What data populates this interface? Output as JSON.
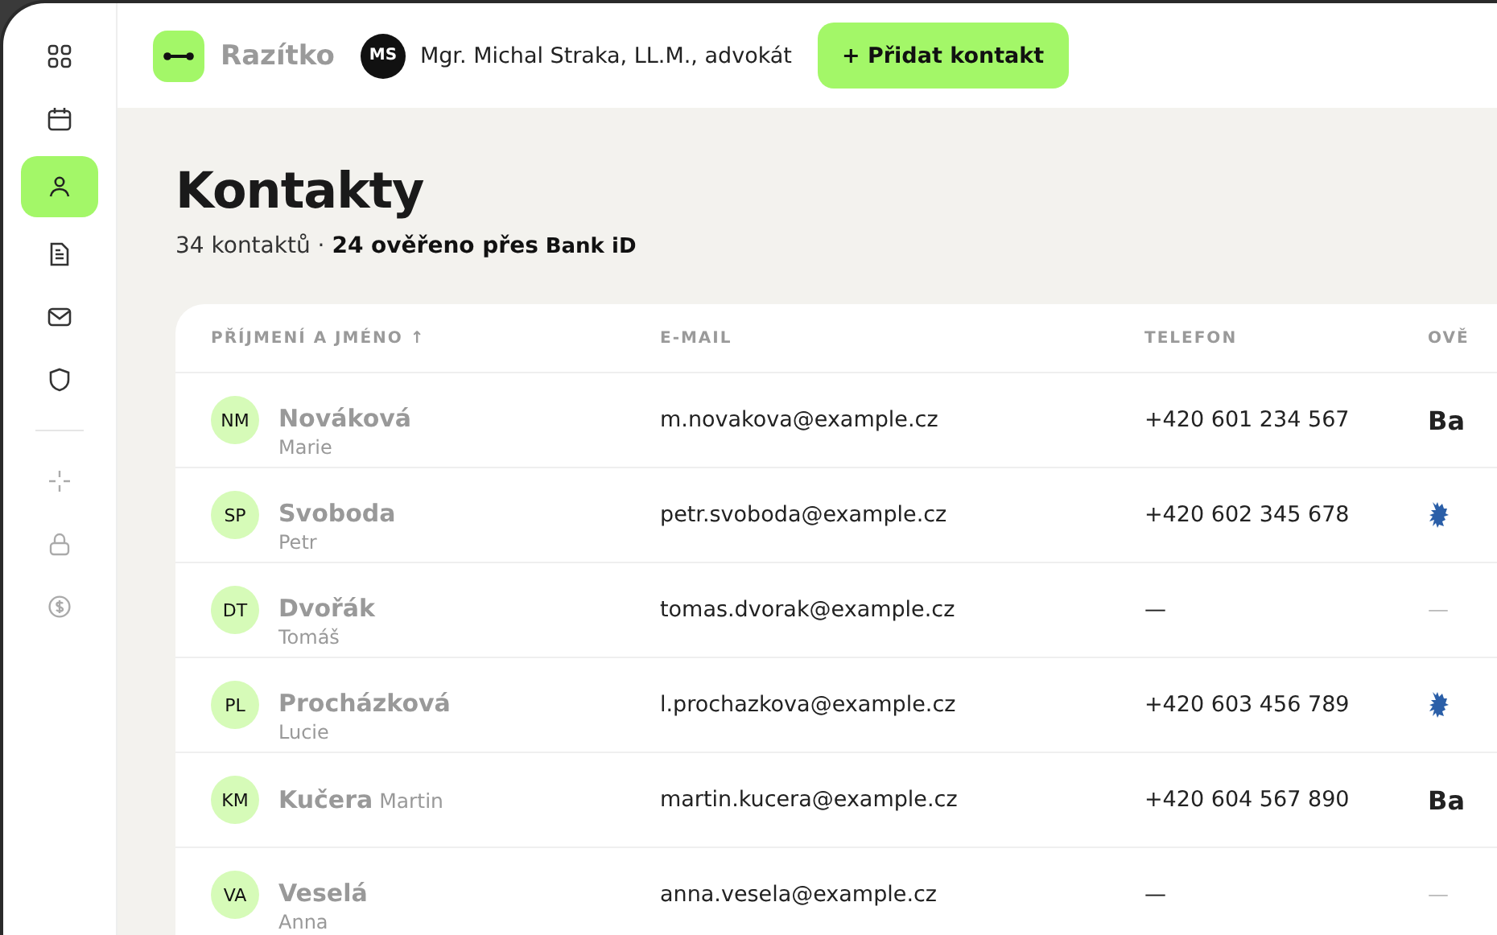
{
  "sidebar": {
    "items": [
      {
        "selected": false
      },
      {
        "selected": false
      },
      {
        "selected": true
      },
      {
        "selected": false
      },
      {
        "selected": false
      },
      {
        "selected": false
      }
    ],
    "tools": [
      {
        "selected": false
      },
      {
        "selected": false
      },
      {
        "selected": false
      }
    ]
  },
  "topbar": {
    "app_name": "Razítko",
    "user": {
      "initials": "MS",
      "name": "Mgr. Michal Straka, LL.M., advokát"
    },
    "add_button": "+ Přidat kontakt"
  },
  "page": {
    "title": "Kontakty",
    "count": "34 kontaktů",
    "separator": "·",
    "verified": "24 ověřeno přes",
    "bankid": "Bank iD"
  },
  "table": {
    "columns": [
      "PŘÍJMENÍ A JMÉNO ↑",
      "E-MAIL",
      "TELEFON",
      "OVĚ"
    ],
    "rows": [
      {
        "initials": "NM",
        "surname": "Nováková",
        "first_name": "Marie",
        "kind": "stacked",
        "email": "m.novakova@example.cz",
        "phone": "+420 601 234 567",
        "verification": {
          "kind": "bankid",
          "text": "Ba"
        }
      },
      {
        "initials": "SP",
        "surname": "Svoboda",
        "first_name": "Petr",
        "kind": "stacked",
        "email": "petr.svoboda@example.cz",
        "phone": "+420 602 345 678",
        "verification": {
          "kind": "emblem"
        }
      },
      {
        "initials": "DT",
        "surname": "Dvořák",
        "first_name": "Tomáš",
        "kind": "stacked",
        "email": "tomas.dvorak@example.cz",
        "phone": "—",
        "verification": {
          "kind": "none",
          "text": "—"
        }
      },
      {
        "initials": "PL",
        "surname": "Procházková",
        "first_name": "Lucie",
        "kind": "stacked",
        "email": "l.prochazkova@example.cz",
        "phone": "+420 603 456 789",
        "verification": {
          "kind": "emblem"
        }
      },
      {
        "initials": "KM",
        "full_name": "**Kučera** Martin",
        "kind": "inline",
        "email": "martin.kucera@example.cz",
        "phone": "+420 604 567 890",
        "verification": {
          "kind": "bankid",
          "text": "Ba"
        }
      },
      {
        "initials": "VA",
        "surname": "Veselá",
        "first_name": "Anna",
        "kind": "stacked",
        "email": "anna.vesela@example.cz",
        "phone": "—",
        "verification": {
          "kind": "none",
          "text": "—"
        }
      }
    ]
  }
}
